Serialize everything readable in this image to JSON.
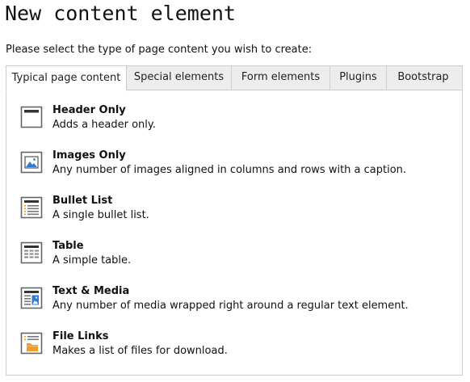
{
  "page": {
    "title": "New content element",
    "subtitle": "Please select the type of page content you wish to create:"
  },
  "tabs": [
    {
      "label": "Typical page content",
      "active": true
    },
    {
      "label": "Special elements",
      "active": false
    },
    {
      "label": "Form elements",
      "active": false
    },
    {
      "label": "Plugins",
      "active": false
    },
    {
      "label": "Bootstrap",
      "active": false
    }
  ],
  "items": [
    {
      "title": "Header Only",
      "description": "Adds a header only.",
      "icon": "header-icon"
    },
    {
      "title": "Images Only",
      "description": "Any number of images aligned in columns and rows with a caption.",
      "icon": "image-icon"
    },
    {
      "title": "Bullet List",
      "description": "A single bullet list.",
      "icon": "bullet-list-icon"
    },
    {
      "title": "Table",
      "description": "A simple table.",
      "icon": "table-icon"
    },
    {
      "title": "Text & Media",
      "description": "Any number of media wrapped right around a regular text element.",
      "icon": "text-media-icon"
    },
    {
      "title": "File Links",
      "description": "Makes a list of files for download.",
      "icon": "file-links-icon"
    }
  ],
  "colors": {
    "icon_frame": "#666666",
    "icon_accent_blue": "#2f7bd1",
    "icon_accent_orange": "#f29d2a",
    "tab_bar_bg": "#ededed",
    "border": "#cccccc"
  }
}
